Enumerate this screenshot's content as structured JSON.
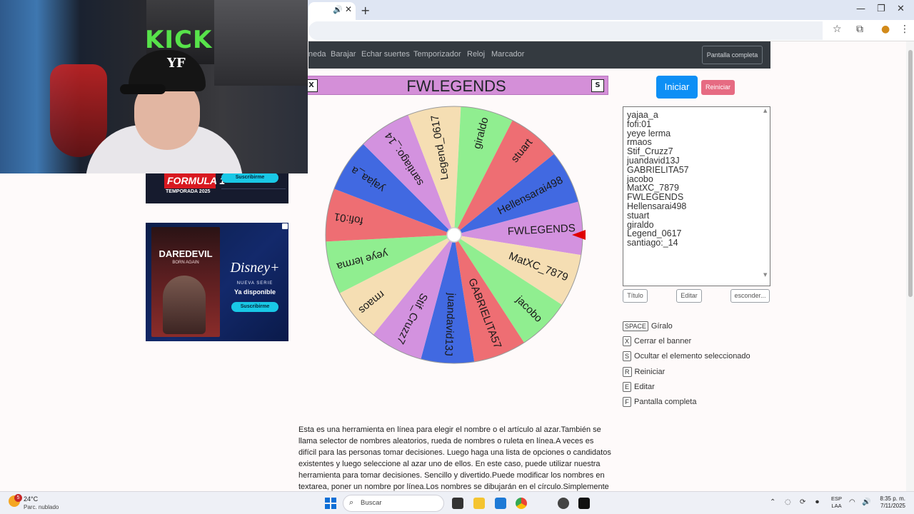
{
  "browser": {
    "new_tab": "+",
    "tab_close": "✕",
    "win_min": "—",
    "win_max": "❐",
    "win_close": "✕"
  },
  "nav": {
    "items": [
      "neda",
      "Barajar",
      "Echar suertes",
      "Temporizador",
      "Reloj",
      "Marcador"
    ],
    "fullscreen_button": "Pantalla completa"
  },
  "wheel": {
    "title": "FWLEGENDS",
    "close_key": "X",
    "hide_key": "S",
    "segments": [
      "FWLEGENDS",
      "MatXC_7879",
      "jacobo",
      "GABRIELITA57",
      "juandavid13J",
      "Stif_Cruzz7",
      "rmaos",
      "yeye lerma",
      "fofi:01",
      "yajaa_a",
      "santiago:_14",
      "Legend_0617",
      "giraldo",
      "stuart",
      "Hellensarai498"
    ],
    "colors": [
      "#d392df",
      "#f5deb3",
      "#90ee90",
      "#ee6e73",
      "#4169e1",
      "#d392df",
      "#f5deb3",
      "#90ee90",
      "#ee6e73",
      "#4169e1",
      "#d392df",
      "#f5deb3",
      "#90ee90",
      "#ee6e73",
      "#4169e1"
    ],
    "pointer_color": "#e00000"
  },
  "controls": {
    "start_button": "Iniciar",
    "reset_button": "Reiniciar",
    "names_text": "yajaa_a\nfofi:01\nyeye lerma\nrmaos\nStif_Cruzz7\njuandavid13J\nGABRIELITA57\njacobo\nMatXC_7879\nFWLEGENDS\nHellensarai498\nstuart\ngiraldo\nLegend_0617\nsantiago:_14",
    "title_button": "Título",
    "edit_button": "Editar",
    "hide_button": "esconder..."
  },
  "shortcuts": [
    {
      "key": "SPACE",
      "label": "Gíralo"
    },
    {
      "key": "X",
      "label": "Cerrar el banner"
    },
    {
      "key": "S",
      "label": "Ocultar el elemento seleccionado"
    },
    {
      "key": "R",
      "label": "Reiniciar"
    },
    {
      "key": "E",
      "label": "Editar"
    },
    {
      "key": "F",
      "label": "Pantalla completa"
    }
  ],
  "description": "Esta es una herramienta en línea para elegir el nombre o el artículo al azar.También se llama selector de nombres aleatorios, rueda de nombres o ruleta en línea.A veces es difícil para las personas tomar decisiones. Luego haga una lista de opciones o candidatos existentes y luego seleccione al azar uno de ellos. En este caso, puede utilizar nuestra herramienta para tomar decisiones. Sencillo y divertido.Puede modificar los nombres en textarea, poner un nombre por línea.Los nombres se dibujarán en el círculo.Simplemente haga clic en la rueda",
  "ads": {
    "f1": {
      "logo": "FORMULA 1",
      "subtitle": "TEMPORADA 2025",
      "cta": "Suscribirme"
    },
    "disney": {
      "poster_title": "DAREDEVIL",
      "poster_sub": "BORN AGAIN",
      "brand": "Disney+",
      "tagline": "NUEVA SERIE",
      "headline": "Ya disponible",
      "cta": "Suscribirme"
    }
  },
  "webcam": {
    "sign": "KICK",
    "cap_logo": "YF"
  },
  "taskbar": {
    "weather_badge": "5",
    "temperature": "24°C",
    "condition": "Parc. nublado",
    "search_placeholder": "Buscar",
    "lang_top": "ESP",
    "lang_bottom": "LAA",
    "time": "8:35 p. m.",
    "date": "7/11/2025"
  }
}
